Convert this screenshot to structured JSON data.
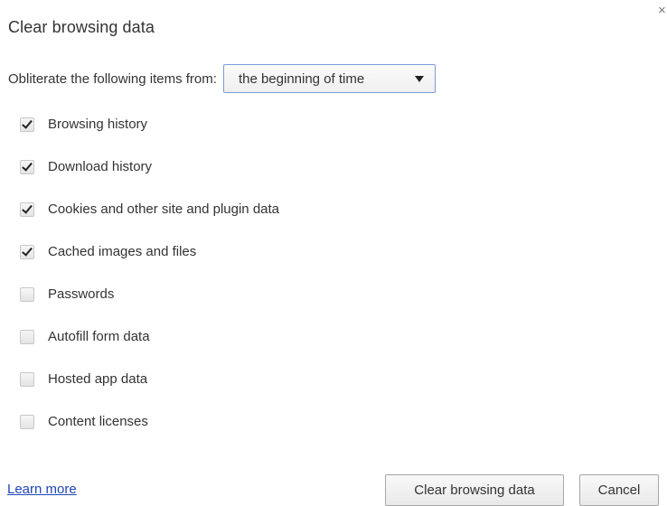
{
  "dialog": {
    "title": "Clear browsing data",
    "close_glyph": "×"
  },
  "range": {
    "label": "Obliterate the following items from:",
    "selected": "the beginning of time"
  },
  "items": [
    {
      "label": "Browsing history",
      "checked": true
    },
    {
      "label": "Download history",
      "checked": true
    },
    {
      "label": "Cookies and other site and plugin data",
      "checked": true
    },
    {
      "label": "Cached images and files",
      "checked": true
    },
    {
      "label": "Passwords",
      "checked": false
    },
    {
      "label": "Autofill form data",
      "checked": false
    },
    {
      "label": "Hosted app data",
      "checked": false
    },
    {
      "label": "Content licenses",
      "checked": false
    }
  ],
  "footer": {
    "learn_more": "Learn more",
    "clear_button": "Clear browsing data",
    "cancel_button": "Cancel"
  },
  "colors": {
    "link": "#1f45b8",
    "select_border": "#7a9cd6"
  }
}
